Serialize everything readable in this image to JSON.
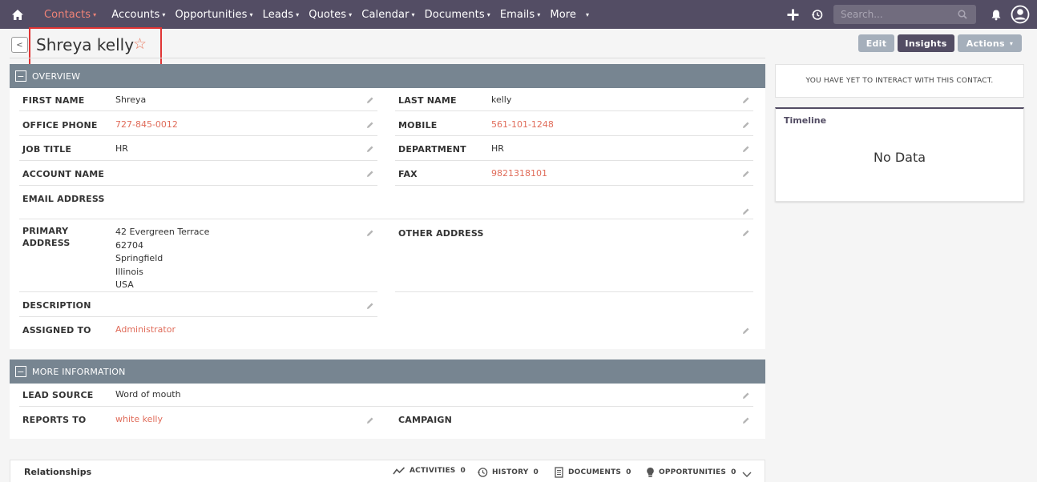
{
  "nav": {
    "items": [
      {
        "label": "Contacts",
        "active": true
      },
      {
        "label": "Accounts"
      },
      {
        "label": "Opportunities"
      },
      {
        "label": "Leads"
      },
      {
        "label": "Quotes"
      },
      {
        "label": "Calendar"
      },
      {
        "label": "Documents"
      },
      {
        "label": "Emails"
      },
      {
        "label": "More"
      }
    ],
    "search_placeholder": "Search...",
    "icons": [
      "home-icon",
      "plus-icon",
      "history-icon",
      "bell-icon",
      "user-avatar-icon",
      "search-icon"
    ]
  },
  "header": {
    "title": "Shreya kelly",
    "edit_label": "Edit",
    "insights_label": "Insights",
    "actions_label": "Actions",
    "back_icon": "<"
  },
  "overview": {
    "heading": "OVERVIEW",
    "first_name_label": "FIRST NAME",
    "first_name": "Shreya",
    "last_name_label": "LAST NAME",
    "last_name": "kelly",
    "office_phone_label": "OFFICE PHONE",
    "office_phone": "727-845-0012",
    "mobile_label": "MOBILE",
    "mobile": "561-101-1248",
    "job_title_label": "JOB TITLE",
    "job_title": "HR",
    "department_label": "DEPARTMENT",
    "department": "HR",
    "account_name_label": "ACCOUNT NAME",
    "account_name": "",
    "fax_label": "FAX",
    "fax": "9821318101",
    "email_label": "EMAIL ADDRESS",
    "email": "",
    "primary_address_label": "PRIMARY",
    "primary_address_label2": "ADDRESS",
    "primary_address": [
      "42 Evergreen Terrace",
      "62704",
      "Springfield",
      "Illinois",
      "USA"
    ],
    "other_address_label": "OTHER ADDRESS",
    "other_address": "",
    "description_label": "DESCRIPTION",
    "description": "",
    "assigned_to_label": "ASSIGNED TO",
    "assigned_to": "Administrator"
  },
  "more_info": {
    "heading": "MORE INFORMATION",
    "lead_source_label": "LEAD SOURCE",
    "lead_source": "Word of mouth",
    "reports_to_label": "REPORTS TO",
    "reports_to": "white kelly",
    "campaign_label": "CAMPAIGN",
    "campaign": ""
  },
  "sidebar": {
    "interaction_text": "YOU HAVE YET TO INTERACT WITH THIS CONTACT.",
    "timeline_title": "Timeline",
    "timeline_empty": "No Data"
  },
  "relationships": {
    "title": "Relationships",
    "tabs": [
      {
        "label": "ACTIVITIES",
        "count": "0",
        "icon": "activities-icon"
      },
      {
        "label": "HISTORY",
        "count": "0",
        "icon": "history-icon"
      },
      {
        "label": "DOCUMENTS",
        "count": "0",
        "icon": "documents-icon"
      },
      {
        "label": "OPPORTUNITIES",
        "count": "0",
        "icon": "lightbulb-icon"
      }
    ]
  },
  "colors": {
    "nav_bg": "#534d64",
    "accent": "#e06c5a",
    "panel_head": "#778591",
    "button_grey": "#a5afbb",
    "title_highlight": "#e03535"
  }
}
